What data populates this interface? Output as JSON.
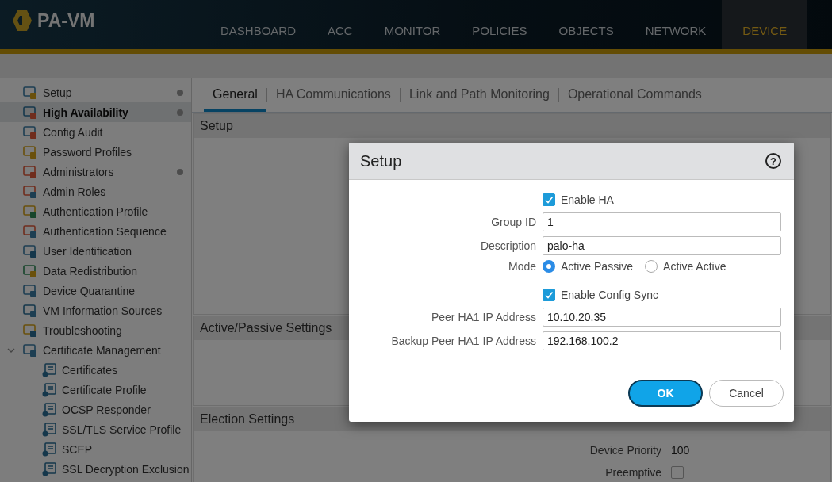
{
  "header": {
    "logo": "PA-VM",
    "nav": [
      {
        "label": "DASHBOARD",
        "selected": false
      },
      {
        "label": "ACC",
        "selected": false
      },
      {
        "label": "MONITOR",
        "selected": false
      },
      {
        "label": "POLICIES",
        "selected": false
      },
      {
        "label": "OBJECTS",
        "selected": false
      },
      {
        "label": "NETWORK",
        "selected": false
      },
      {
        "label": "DEVICE",
        "selected": true
      }
    ]
  },
  "sidebar": {
    "items": [
      {
        "label": "Setup",
        "selected": false,
        "dot": true
      },
      {
        "label": "High Availability",
        "selected": true,
        "dot": true
      },
      {
        "label": "Config Audit",
        "selected": false,
        "dot": false
      },
      {
        "label": "Password Profiles",
        "selected": false,
        "dot": false
      },
      {
        "label": "Administrators",
        "selected": false,
        "dot": true
      },
      {
        "label": "Admin Roles",
        "selected": false,
        "dot": false
      },
      {
        "label": "Authentication Profile",
        "selected": false,
        "dot": false
      },
      {
        "label": "Authentication Sequence",
        "selected": false,
        "dot": false
      },
      {
        "label": "User Identification",
        "selected": false,
        "dot": false
      },
      {
        "label": "Data Redistribution",
        "selected": false,
        "dot": false
      },
      {
        "label": "Device Quarantine",
        "selected": false,
        "dot": false
      },
      {
        "label": "VM Information Sources",
        "selected": false,
        "dot": false
      },
      {
        "label": "Troubleshooting",
        "selected": false,
        "dot": false
      },
      {
        "label": "Certificate Management",
        "selected": false,
        "dot": false,
        "expanded": true,
        "children": [
          {
            "label": "Certificates",
            "selected": false
          },
          {
            "label": "Certificate Profile",
            "selected": false
          },
          {
            "label": "OCSP Responder",
            "selected": false
          },
          {
            "label": "SSL/TLS Service Profile",
            "selected": false
          },
          {
            "label": "SCEP",
            "selected": false
          },
          {
            "label": "SSL Decryption Exclusion",
            "selected": false
          }
        ]
      }
    ]
  },
  "tabs": [
    {
      "label": "General",
      "selected": true
    },
    {
      "label": "HA Communications",
      "selected": false
    },
    {
      "label": "Link and Path Monitoring",
      "selected": false
    },
    {
      "label": "Operational Commands",
      "selected": false
    }
  ],
  "sections": [
    {
      "title": "Setup"
    },
    {
      "title": "Active/Passive Settings"
    },
    {
      "title": "Election Settings",
      "fields": [
        {
          "kind": "text",
          "label": "Device Priority",
          "value": "100"
        },
        {
          "kind": "checkbox",
          "label": "Preemptive",
          "checked": false
        }
      ]
    }
  ],
  "dialog": {
    "title": "Setup",
    "help": "?",
    "fields": [
      {
        "kind": "checkbox",
        "label": "Enable HA",
        "checked": true
      },
      {
        "kind": "text",
        "label": "Group ID",
        "value": "1"
      },
      {
        "kind": "text",
        "label": "Description",
        "value": "palo-ha"
      },
      {
        "kind": "radio",
        "label": "Mode",
        "options": [
          {
            "label": "Active Passive",
            "selected": true
          },
          {
            "label": "Active Active",
            "selected": false
          }
        ]
      },
      {
        "kind": "checkbox",
        "label": "Enable Config Sync",
        "checked": true
      },
      {
        "kind": "text",
        "label": "Peer HA1 IP Address",
        "value": "10.10.20.35"
      },
      {
        "kind": "text",
        "label": "Backup Peer HA1 IP Address",
        "value": "192.168.100.2"
      }
    ],
    "buttons": [
      {
        "label": "OK",
        "primary": true
      },
      {
        "label": "Cancel",
        "primary": false
      }
    ]
  }
}
